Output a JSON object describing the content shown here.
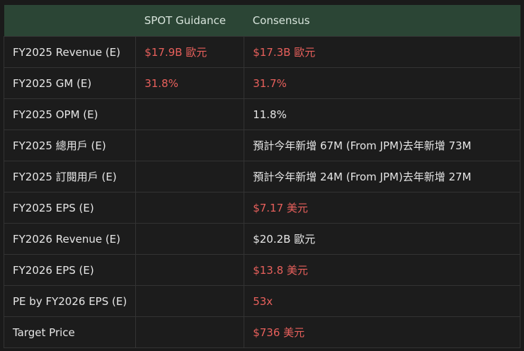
{
  "headers": [
    "",
    "SPOT Guidance",
    "Consensus"
  ],
  "rows": [
    {
      "label": "FY2025 Revenue (E)",
      "guidance": "$17.9B 歐元",
      "consensus": "$17.3B 歐元",
      "g_red": true,
      "c_red": true
    },
    {
      "label": "FY2025 GM (E)",
      "guidance": "31.8%",
      "consensus": "31.7%",
      "g_red": true,
      "c_red": true
    },
    {
      "label": "FY2025 OPM (E)",
      "guidance": "",
      "consensus": "11.8%",
      "g_red": false,
      "c_red": false
    },
    {
      "label": "FY2025 總用戶 (E)",
      "guidance": "",
      "consensus": "預計今年新增 67M (From JPM)去年新增 73M",
      "g_red": false,
      "c_red": false
    },
    {
      "label": "FY2025 訂閱用戶 (E)",
      "guidance": "",
      "consensus": "預計今年新增 24M (From JPM)去年新增 27M",
      "g_red": false,
      "c_red": false
    },
    {
      "label": "FY2025 EPS (E)",
      "guidance": "",
      "consensus": "$7.17 美元",
      "g_red": false,
      "c_red": true
    },
    {
      "label": "FY2026 Revenue (E)",
      "guidance": "",
      "consensus": "$20.2B 歐元",
      "g_red": false,
      "c_red": false
    },
    {
      "label": "FY2026 EPS (E)",
      "guidance": "",
      "consensus": "$13.8 美元",
      "g_red": false,
      "c_red": true
    },
    {
      "label": "PE by FY2026 EPS (E)",
      "guidance": "",
      "consensus": "53x",
      "g_red": false,
      "c_red": true
    },
    {
      "label": "Target Price",
      "guidance": "",
      "consensus": "$736 美元",
      "g_red": false,
      "c_red": true
    }
  ],
  "colors": {
    "header_bg": "#2b4535",
    "highlight": "#e8605c"
  }
}
